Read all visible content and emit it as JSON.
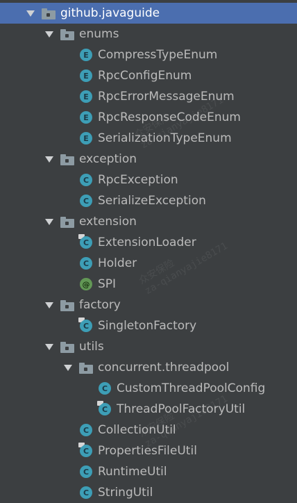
{
  "tree": {
    "root": {
      "label": "github.javaguide"
    },
    "enums": {
      "label": "enums",
      "items": [
        "CompressTypeEnum",
        "RpcConfigEnum",
        "RpcErrorMessageEnum",
        "RpcResponseCodeEnum",
        "SerializationTypeEnum"
      ]
    },
    "exception": {
      "label": "exception",
      "items": [
        "RpcException",
        "SerializeException"
      ]
    },
    "extension": {
      "label": "extension",
      "items": [
        "ExtensionLoader",
        "Holder",
        "SPI"
      ]
    },
    "factory": {
      "label": "factory",
      "items": [
        "SingletonFactory"
      ]
    },
    "utils": {
      "label": "utils",
      "concurrent": {
        "label": "concurrent.threadpool",
        "items": [
          "CustomThreadPoolConfig",
          "ThreadPoolFactoryUtil"
        ]
      },
      "items": [
        "CollectionUtil",
        "PropertiesFileUtil",
        "RuntimeUtil",
        "StringUtil"
      ]
    }
  },
  "icons": {
    "enum_letter": "E",
    "class_letter": "C",
    "annotation_letter": "@"
  },
  "watermark": {
    "line1": "众安保险",
    "line2": "za-qianyajie8171"
  },
  "colors": {
    "background": "#3c3f41",
    "selection": "#4b6eaf",
    "text": "#bbbbbb",
    "class_icon": "#3d9eb6",
    "annotation_icon": "#629755",
    "folder": "#8d9ba3"
  }
}
